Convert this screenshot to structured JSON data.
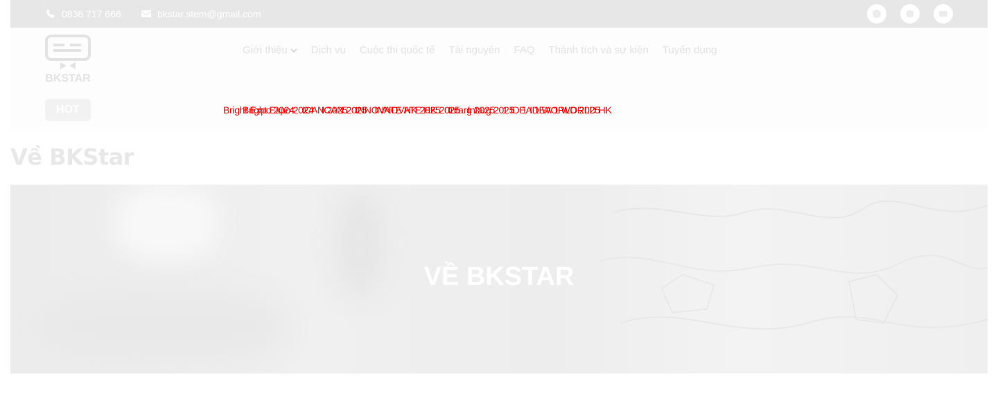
{
  "topbar": {
    "phone": "0836 717 666",
    "email": "bkstar.stem@gmail.com",
    "socials": [
      "facebook-icon",
      "instagram-icon",
      "youtube-icon"
    ]
  },
  "logo": {
    "text": "BKSTAR"
  },
  "nav": {
    "items": [
      {
        "label": "Giới thiệu"
      },
      {
        "label": "Dịch vụ"
      },
      {
        "label": "Cuộc thi quốc tế"
      },
      {
        "label": "Tài nguyên"
      },
      {
        "label": "FAQ"
      },
      {
        "label": "Thành tích và sự kiện"
      },
      {
        "label": "Tuyển dụng"
      }
    ]
  },
  "hot": {
    "label": "HOT",
    "ticker": {
      "row1": [
        "Bright Expo 2024",
        "ICAN 2025",
        "INNOVATE HK 2025",
        "Intarg 2025",
        "1 IDEA 1 WORLD 2025"
      ],
      "row2": [
        "Bright Expo 2024",
        "ICAN 2025",
        "INNOVATE HK 2025",
        "Intarg 2025",
        "1 IDEA 1 WORLD HK"
      ]
    }
  },
  "page": {
    "title": "Về BKStar"
  },
  "banner": {
    "title": "VỀ BKSTAR"
  },
  "colors": {
    "ticker": "#ff0000",
    "topbar_bg": "#e7e7e7"
  }
}
